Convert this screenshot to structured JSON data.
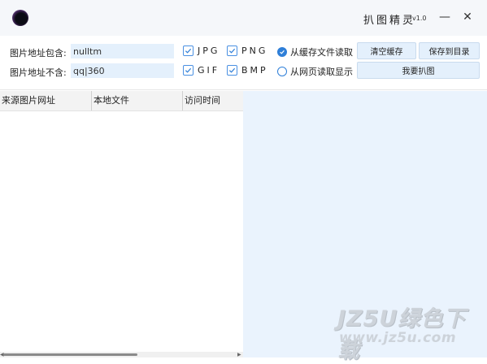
{
  "app": {
    "title": "扒图精灵",
    "version": "v1.0"
  },
  "window_controls": {
    "minimize": "—",
    "close": "✕"
  },
  "filters": {
    "include_label": "图片地址包含:",
    "include_value": "nulltm",
    "exclude_label": "图片地址不含:",
    "exclude_value": "qq|360"
  },
  "formats": [
    {
      "label": "JPG",
      "checked": true
    },
    {
      "label": "PNG",
      "checked": true
    },
    {
      "label": "GIF",
      "checked": true
    },
    {
      "label": "BMP",
      "checked": true
    }
  ],
  "source": {
    "options": [
      {
        "label": "从缓存文件读取",
        "selected": true
      },
      {
        "label": "从网页读取显示",
        "selected": false
      }
    ]
  },
  "buttons": {
    "clear_cache": "清空缓存",
    "save_to_dir": "保存到目录",
    "grab": "我要扒图"
  },
  "table": {
    "columns": [
      "来源图片网址",
      "本地文件",
      "访问时间"
    ],
    "rows": []
  },
  "watermark": {
    "main": "JZ5U绿色下载",
    "url": "www.jz5u.com"
  },
  "colors": {
    "accent": "#2f7fd8",
    "input_bg": "#e4f0fc",
    "preview_bg": "#eaf3fd"
  }
}
